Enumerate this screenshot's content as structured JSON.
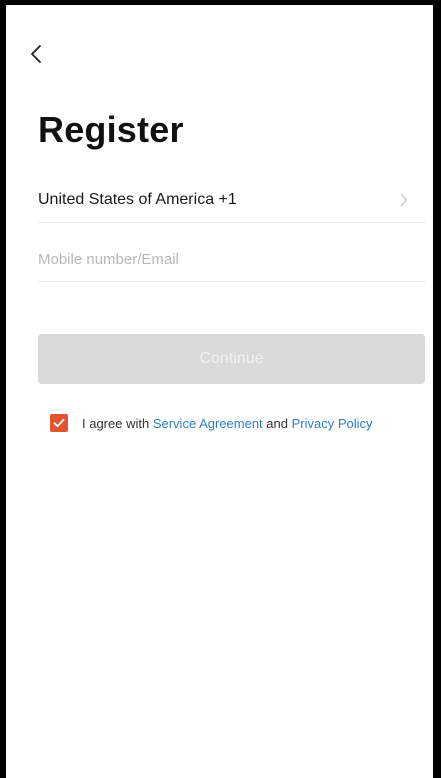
{
  "header": {
    "back_icon": "chevron-left-icon"
  },
  "page": {
    "title": "Register"
  },
  "country_selector": {
    "label": "United States of America +1",
    "chevron_icon": "chevron-right-icon"
  },
  "account_input": {
    "value": "",
    "placeholder": "Mobile number/Email"
  },
  "continue_button": {
    "label": "Continue",
    "state": "disabled"
  },
  "agreement": {
    "checked": true,
    "prefix": "I agree with",
    "service_link": "Service Agreement",
    "conjunction": "and",
    "privacy_link": "Privacy Policy"
  },
  "colors": {
    "accent_checkbox": "#e0552f",
    "link": "#2d7fc8",
    "disabled_button_bg": "#d9d9d9",
    "divider": "#e6e6e6"
  }
}
